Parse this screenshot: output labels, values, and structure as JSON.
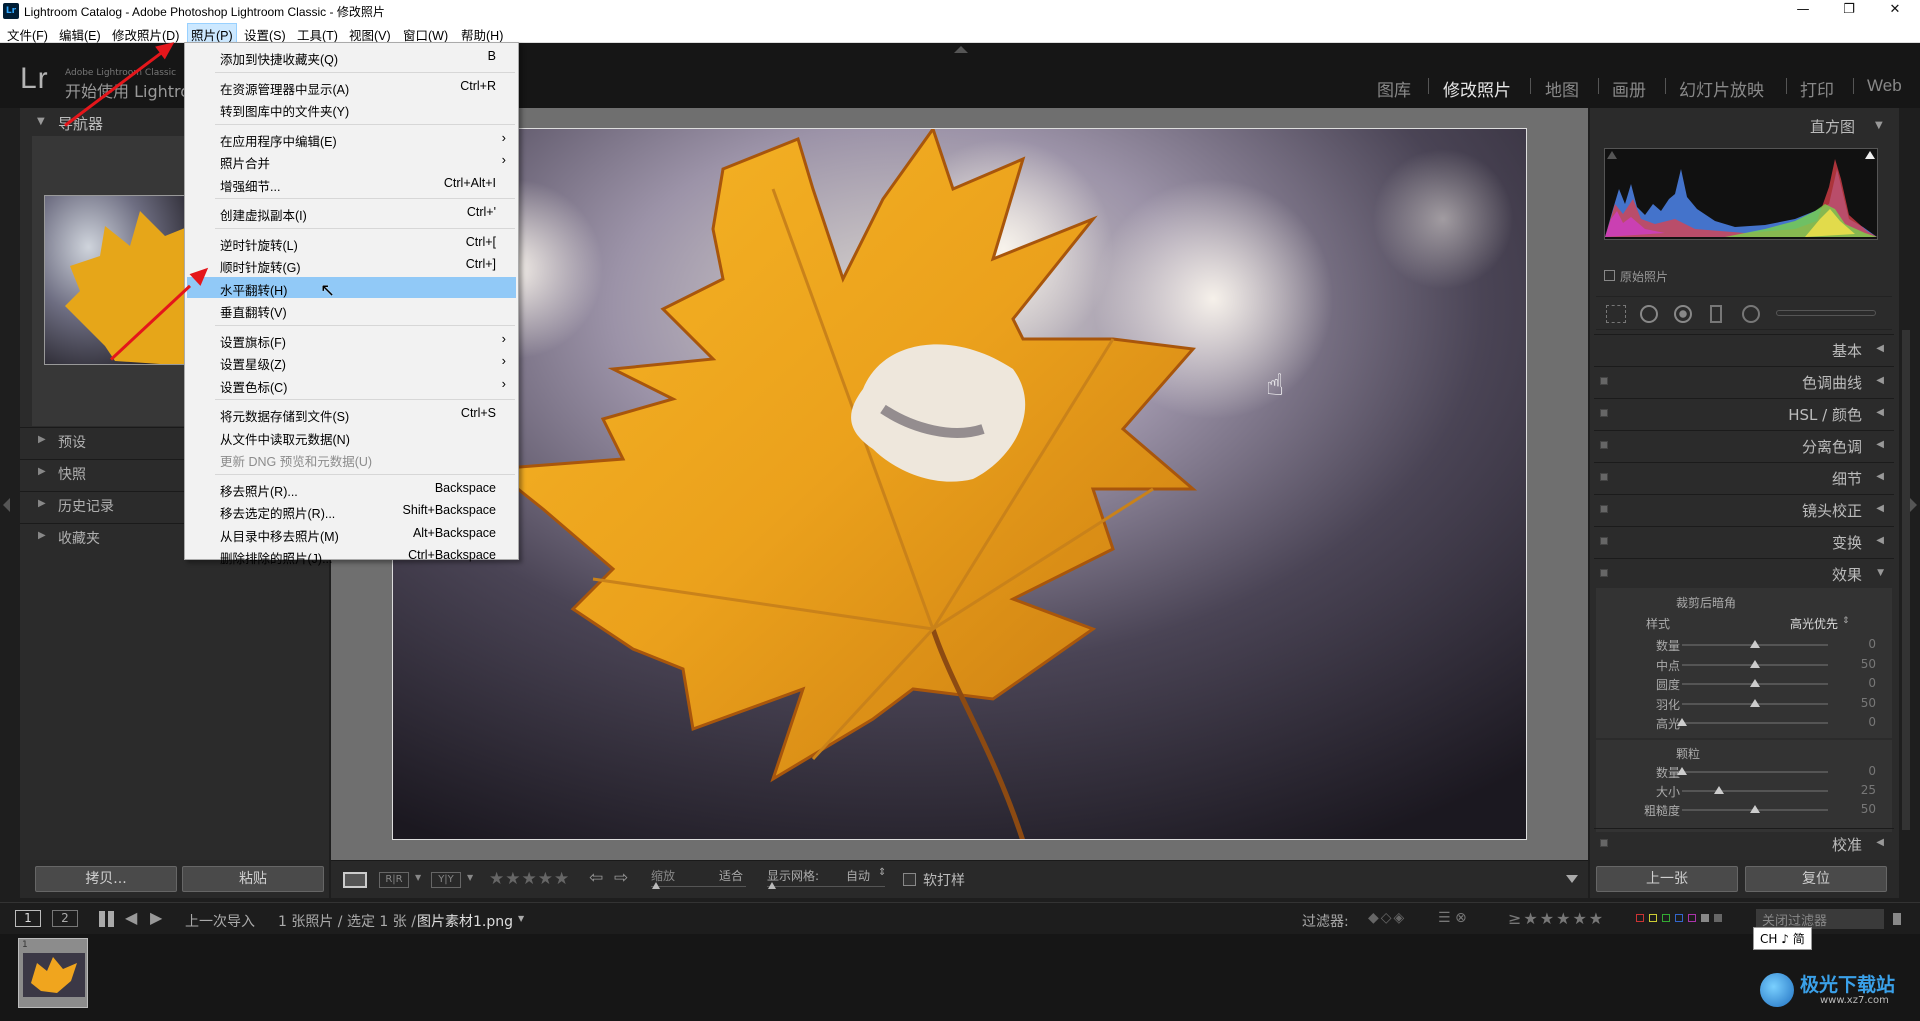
{
  "window": {
    "title": "Lightroom Catalog - Adobe Photoshop Lightroom Classic - 修改照片",
    "app_icon": "Lr"
  },
  "menubar": {
    "items": [
      "文件(F)",
      "编辑(E)",
      "修改照片(D)",
      "照片(P)",
      "设置(S)",
      "工具(T)",
      "视图(V)",
      "窗口(W)",
      "帮助(H)"
    ],
    "active_index": 3
  },
  "identity": {
    "logo": "Lr",
    "product": "Adobe Lightroom Classic",
    "welcome": "开始使用 Lightroom"
  },
  "modules": {
    "items": [
      "图库",
      "修改照片",
      "地图",
      "画册",
      "幻灯片放映",
      "打印",
      "Web"
    ],
    "active": "修改照片"
  },
  "photo_menu": {
    "items": [
      {
        "label": "添加到快捷收藏夹(Q)",
        "shortcut": "B"
      },
      {
        "label": "在资源管理器中显示(A)",
        "shortcut": "Ctrl+R"
      },
      {
        "label": "转到图库中的文件夹(Y)",
        "shortcut": ""
      },
      {
        "label": "在应用程序中编辑(E)",
        "shortcut": "",
        "submenu": true
      },
      {
        "label": "照片合并",
        "shortcut": "",
        "submenu": true
      },
      {
        "label": "增强细节...",
        "shortcut": "Ctrl+Alt+I"
      },
      {
        "label": "创建虚拟副本(I)",
        "shortcut": "Ctrl+'"
      },
      {
        "label": "逆时针旋转(L)",
        "shortcut": "Ctrl+["
      },
      {
        "label": "顺时针旋转(G)",
        "shortcut": "Ctrl+]"
      },
      {
        "label": "水平翻转(H)",
        "shortcut": "",
        "highlighted": true
      },
      {
        "label": "垂直翻转(V)",
        "shortcut": ""
      },
      {
        "label": "设置旗标(F)",
        "shortcut": "",
        "submenu": true
      },
      {
        "label": "设置星级(Z)",
        "shortcut": "",
        "submenu": true
      },
      {
        "label": "设置色标(C)",
        "shortcut": "",
        "submenu": true
      },
      {
        "label": "将元数据存储到文件(S)",
        "shortcut": "Ctrl+S"
      },
      {
        "label": "从文件中读取元数据(N)",
        "shortcut": ""
      },
      {
        "label": "更新 DNG 预览和元数据(U)",
        "shortcut": "",
        "disabled": true
      },
      {
        "label": "移去照片(R)...",
        "shortcut": "Backspace"
      },
      {
        "label": "移去选定的照片(R)...",
        "shortcut": "Shift+Backspace"
      },
      {
        "label": "从目录中移去照片(M)",
        "shortcut": "Alt+Backspace"
      },
      {
        "label": "删除排除的照片(J)...",
        "shortcut": "Ctrl+Backspace"
      }
    ],
    "submenu_arrow": "›"
  },
  "left_panel": {
    "navigator": "导航器",
    "sections": [
      "预设",
      "快照",
      "历史记录",
      "收藏夹"
    ],
    "copy_button": "拷贝...",
    "paste_button": "粘贴"
  },
  "right_panel": {
    "histogram": "直方图",
    "original_photo": "原始照片",
    "sections": [
      "基本",
      "色调曲线",
      "HSL / 颜色",
      "分离色调",
      "细节",
      "镜头校正",
      "变换",
      "效果"
    ],
    "vignette": {
      "title": "裁剪后暗角",
      "style_label": "样式",
      "style_value": "高光优先",
      "sliders": [
        {
          "label": "数量",
          "value": "0",
          "pos": 0.5
        },
        {
          "label": "中点",
          "value": "50",
          "pos": 0.5
        },
        {
          "label": "圆度",
          "value": "0",
          "pos": 0.5
        },
        {
          "label": "羽化",
          "value": "50",
          "pos": 0.5
        },
        {
          "label": "高光",
          "value": "0",
          "pos": 0.0
        }
      ]
    },
    "grain": {
      "title": "颗粒",
      "sliders": [
        {
          "label": "数量",
          "value": "0",
          "pos": 0.0
        },
        {
          "label": "大小",
          "value": "25",
          "pos": 0.25
        },
        {
          "label": "粗糙度",
          "value": "50",
          "pos": 0.5
        }
      ]
    },
    "calibration": "校准",
    "prev_button": "上一张",
    "reset_button": "复位"
  },
  "toolbar": {
    "zoom_label": "缩放",
    "zoom_value": "适合",
    "grid_label": "显示网格:",
    "grid_value": "自动",
    "softproof_label": "软打样",
    "rating_stars": "★★★★★"
  },
  "filmstrip_bar": {
    "page1": "1",
    "page2": "2",
    "source": "上一次导入",
    "count": "1 张照片 / 选定 1 张 /",
    "filename": "图片素材1.png",
    "filter_label": "过滤器:",
    "filter_off": "关闭过滤器",
    "ime": "CH ♪ 简"
  },
  "filmstrip": {
    "thumb_number": "1"
  },
  "watermark": {
    "text": "极光下载站",
    "url": "www.xz7.com"
  }
}
